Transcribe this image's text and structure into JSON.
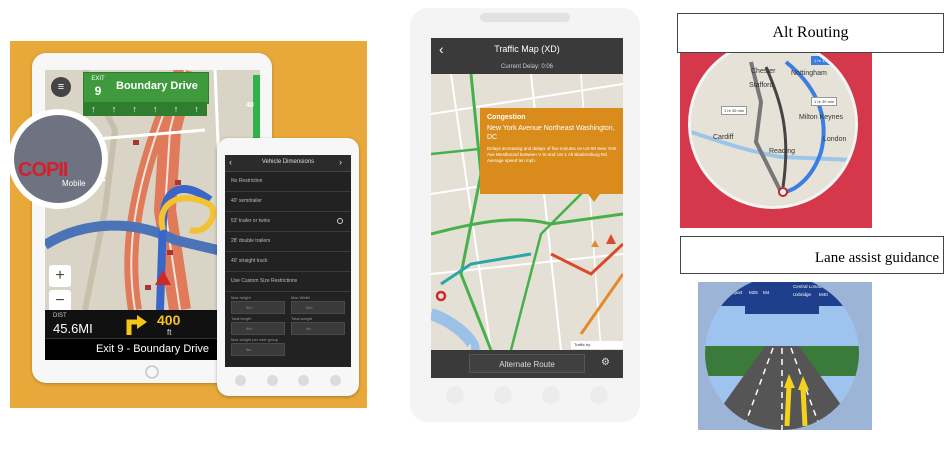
{
  "panel1": {
    "exit_sign": {
      "tag": "EXIT",
      "number": "9",
      "name": "Boundary Drive"
    },
    "lane_arrows": [
      "↑",
      "↑",
      "↑",
      "↑",
      "↑",
      "↑"
    ],
    "speed_value": "40",
    "menu_icon": "menu-icon",
    "zoom_plus": "+",
    "zoom_minus": "−",
    "distance": {
      "label": "DIST",
      "value": "45.6MI"
    },
    "turn": {
      "distance": "400",
      "unit": "ft",
      "extra": "1"
    },
    "street": "Exit 9 - Boundary Drive",
    "copilot": {
      "logo": "COPII",
      "sub": "Mobile"
    },
    "vehicle_dimensions": {
      "title": "Vehicle Dimensions",
      "items": [
        "No Restriction",
        "40' semitrailer",
        "53' trailer or twins",
        "28' double trailers",
        "40' straight truck",
        "Use Custom Size Restrictions"
      ],
      "fields": [
        {
          "label": "Max height",
          "value": "ft/in"
        },
        {
          "label": "Max Width",
          "value": "ft/in"
        },
        {
          "label": "Total length",
          "value": "ft/in"
        },
        {
          "label": "Total weight",
          "value": "lbs"
        },
        {
          "label": "Max weight per axle group",
          "value": "lbs"
        }
      ]
    }
  },
  "panel2": {
    "title": "Traffic Map (XD)",
    "delay": "Current Delay: 0:06",
    "congestion": {
      "title": "Congestion",
      "address": "New York Avenue Northeast Washington, DC",
      "desc": "Delays increasing and delays of five minutes on US-50 New York Ave Westbound between V St and US-1 Alt Bladensburg Rd. Average speed ten mph."
    },
    "traffic_by": "Traffic by",
    "alternate_route": "Alternate Route"
  },
  "panel3": {
    "label": "Alt Routing",
    "cities": [
      "Chester",
      "Stafford",
      "Nottingham",
      "Milton Keynes",
      "Cardiff",
      "Reading",
      "London"
    ],
    "route_tags": [
      "1 hr 13 min",
      "1 hr 30 min",
      "1 hr 35 min"
    ]
  },
  "panel4": {
    "label": "Lane assist guidance",
    "signs": [
      "Airport",
      "M25",
      "M4",
      "Central London",
      "Uxbridge",
      "M40"
    ]
  },
  "colors": {
    "orange_bg": "#e8a93a",
    "exit_green": "#3e9a3d",
    "congestion_orange": "#d98c1c",
    "alt_red": "#d4384a",
    "lane_blue": "#9cb4d6"
  }
}
